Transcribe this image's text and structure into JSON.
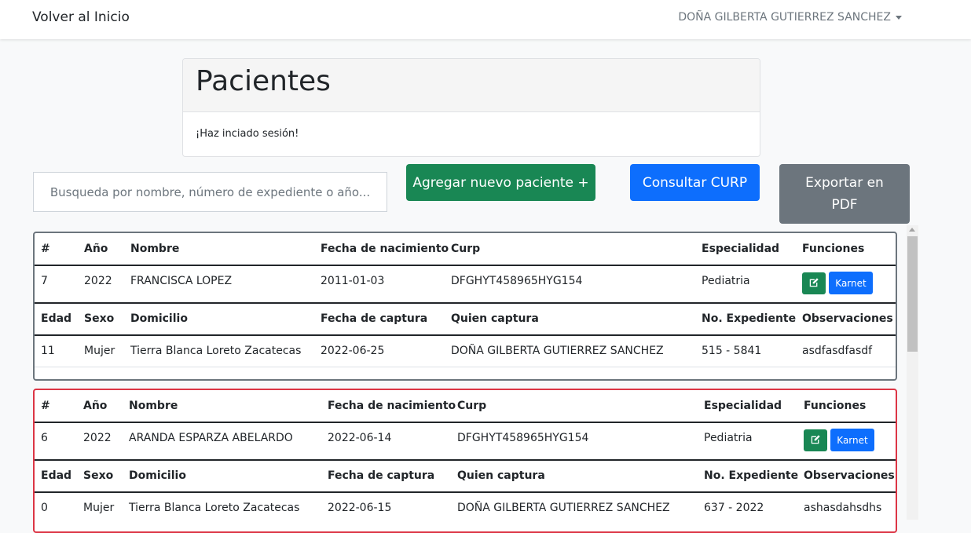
{
  "navbar": {
    "home_label": "Volver al Inicio",
    "user_name": "DOÑA GILBERTA GUTIERREZ SANCHEZ"
  },
  "card": {
    "title": "Pacientes",
    "message": "¡Haz inciado sesión!"
  },
  "search": {
    "placeholder": "Busqueda por nombre, número de expediente o año..."
  },
  "buttons": {
    "add_patient": "Agregar nuevo paciente +",
    "check_curp": "Consultar CURP",
    "export_pdf": "Exportar en PDF"
  },
  "headers_top": [
    "#",
    "Año",
    "Nombre",
    "Fecha de nacimiento",
    "Curp",
    "Especialidad",
    "Funciones"
  ],
  "headers_bottom": [
    "Edad",
    "Sexo",
    "Domicilio",
    "Fecha de captura",
    "Quien captura",
    "No. Expediente",
    "Observaciones"
  ],
  "records": [
    {
      "status_color": "#6c757d",
      "top": [
        "7",
        "2022",
        "FRANCISCA LOPEZ",
        "2011-01-03",
        "DFGHYT458965HYG154",
        "Pediatria"
      ],
      "bottom": [
        "11",
        "Mujer",
        "Tierra Blanca Loreto Zacatecas",
        "2022-06-25",
        "DOÑA GILBERTA GUTIERREZ SANCHEZ",
        "515 - 5841",
        "asdfasdfasdf"
      ],
      "edit_icon": "edit-icon",
      "karnet_label": "Karnet"
    },
    {
      "status_color": "#dc3545",
      "top": [
        "6",
        "2022",
        "ARANDA ESPARZA ABELARDO",
        "2022-06-14",
        "DFGHYT458965HYG154",
        "Pediatria"
      ],
      "bottom": [
        "0",
        "Mujer",
        "Tierra Blanca Loreto Zacatecas",
        "2022-06-15",
        "DOÑA GILBERTA GUTIERREZ SANCHEZ",
        "637 - 2022",
        "ashasdahsdhs"
      ],
      "edit_icon": "edit-icon",
      "karnet_label": "Karnet"
    }
  ]
}
